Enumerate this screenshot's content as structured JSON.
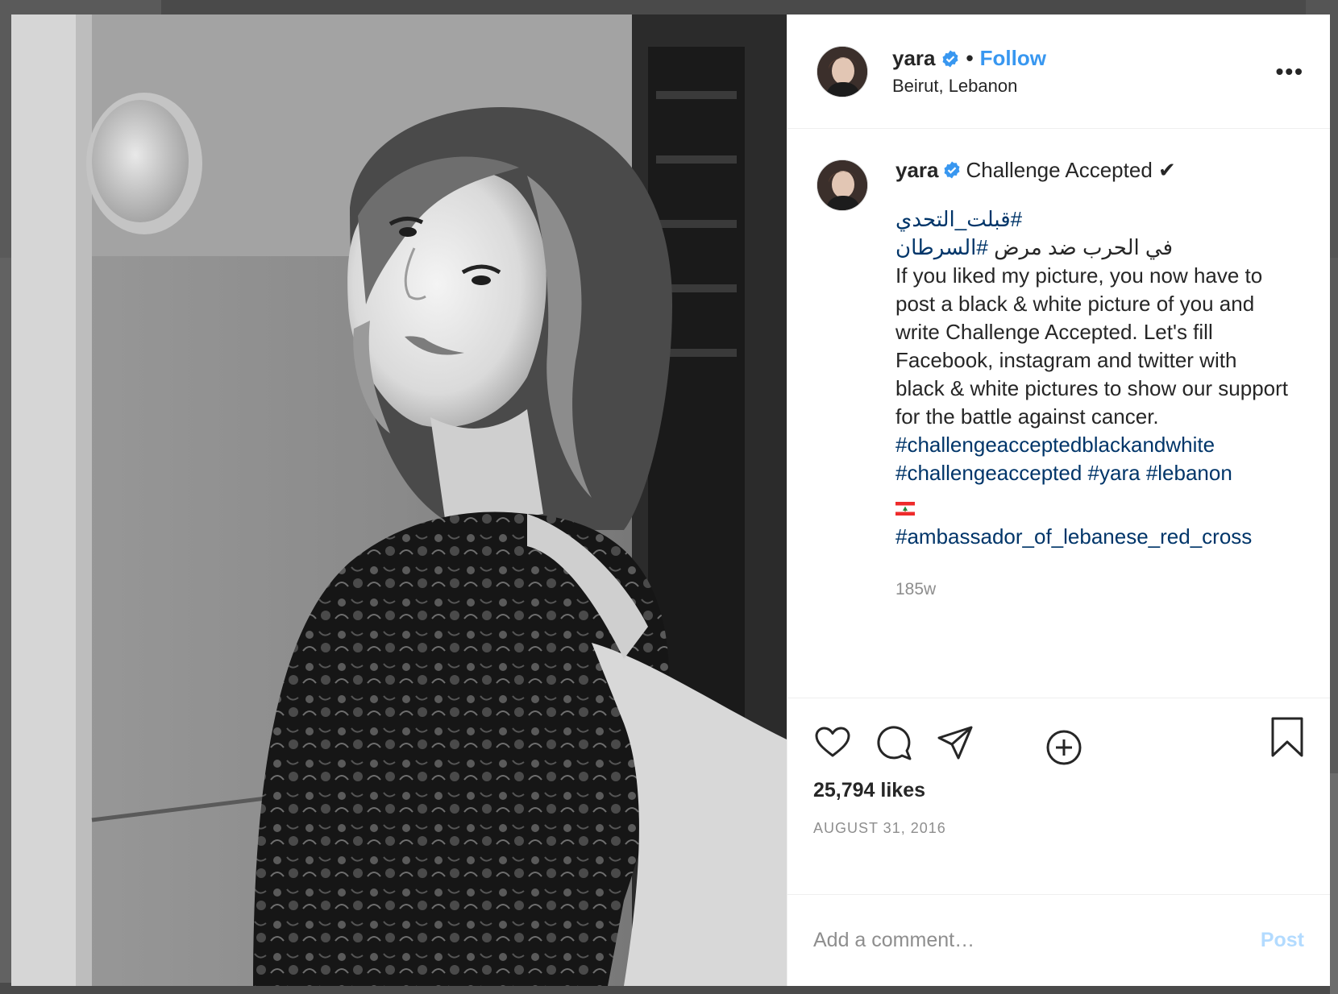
{
  "post": {
    "username": "yara",
    "follow_label": "Follow",
    "separator": "•",
    "location": "Beirut, Lebanon",
    "more_label": "•••",
    "caption": {
      "username": "yara",
      "title": "Challenge Accepted ✔",
      "hashtag_ar_1": "#قبلت_التحدي",
      "ar_line_text": "في الحرب ضد مرض ",
      "hashtag_ar_2": "#السرطان",
      "body": "If you liked my picture, you now have to post a black & white picture of you and write Challenge Accepted. Let's fill Facebook, instagram and twitter with black & white pictures to show our support for the battle against cancer.",
      "hashtags_line1": "#challengeacceptedblackandwhite",
      "hashtag_2": "#challengeaccepted",
      "hashtag_3": "#yara",
      "hashtag_4": "#lebanon",
      "flag": "lebanon-flag",
      "hashtag_5": "#ambassador_of_lebanese_red_cross"
    },
    "time_ago": "185w",
    "likes": "25,794 likes",
    "date": "AUGUST 31, 2016"
  },
  "comment": {
    "placeholder": "Add a comment…",
    "post_label": "Post"
  },
  "colors": {
    "follow": "#3897f0",
    "hashtag": "#003569",
    "muted": "#8e8e8e",
    "post_disabled": "#b3dbff",
    "verified": "#3897f0"
  },
  "icons": [
    "heart-icon",
    "comment-icon",
    "share-icon",
    "bookmark-icon",
    "add-circle-icon",
    "verified-badge-icon",
    "more-options-icon"
  ]
}
